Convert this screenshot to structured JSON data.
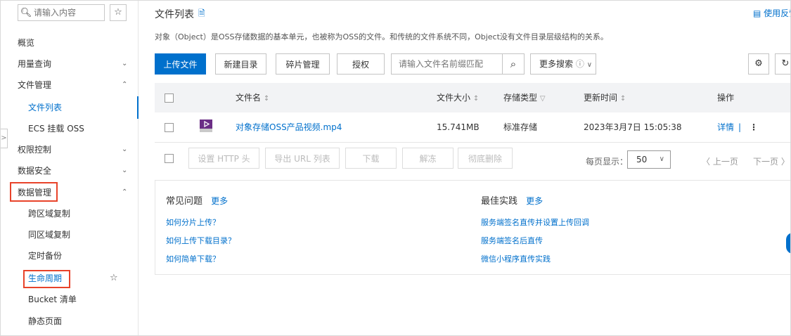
{
  "sidebar": {
    "search_placeholder": "请输入内容",
    "items": [
      {
        "label": "概览"
      },
      {
        "label": "用量查询",
        "chevron": "⌄"
      },
      {
        "label": "文件管理",
        "chevron": "⌃"
      },
      {
        "label": "文件列表"
      },
      {
        "label": "ECS 挂载 OSS"
      },
      {
        "label": "权限控制",
        "chevron": "⌄"
      },
      {
        "label": "数据安全",
        "chevron": "⌄"
      },
      {
        "label": "数据管理",
        "chevron": "⌃"
      },
      {
        "label": "跨区域复制"
      },
      {
        "label": "同区域复制"
      },
      {
        "label": "定时备份"
      },
      {
        "label": "生命周期"
      },
      {
        "label": "Bucket 清单"
      },
      {
        "label": "静态页面"
      }
    ]
  },
  "header": {
    "title": "文件列表",
    "feedback": "使用反馈",
    "description": "对象（Object）是OSS存储数据的基本单元，也被称为OSS的文件。和传统的文件系统不同，Object没有文件目录层级结构的关系。"
  },
  "toolbar": {
    "upload": "上传文件",
    "new_dir": "新建目录",
    "fragments": "碎片管理",
    "authorize": "授权",
    "prefix_placeholder": "请输入文件名前缀匹配",
    "more_search": "更多搜索"
  },
  "table": {
    "columns": {
      "name": "文件名",
      "size": "文件大小",
      "storage": "存储类型",
      "updated": "更新时间",
      "ops": "操作"
    },
    "rows": [
      {
        "name": "对象存储OSS产品视频.mp4",
        "size": "15.741MB",
        "storage": "标准存储",
        "updated": "2023年3月7日 15:05:38",
        "detail": "详情",
        "sep": "|"
      }
    ]
  },
  "bulk_actions": {
    "set_http": "设置 HTTP 头",
    "export_url": "导出 URL 列表",
    "download": "下载",
    "unfreeze": "解冻",
    "delete": "彻底删除"
  },
  "pager": {
    "page_size_label": "每页显示：",
    "page_size": "50",
    "prev": "〈 上一页",
    "next": "下一页 〉"
  },
  "help": {
    "faq_title": "常见问题",
    "faq_more": "更多",
    "faq_links": [
      "如何分片上传？",
      "如何上传下载目录？",
      "如何简单下载？"
    ],
    "best_title": "最佳实践",
    "best_more": "更多",
    "best_links": [
      "服务端签名直传并设置上传回调",
      "服务端签名后直传",
      "微信小程序直传实践"
    ]
  },
  "colors": {
    "accent": "#0070cc",
    "highlight": "#e8432a",
    "video_icon": "#6b2e86"
  }
}
